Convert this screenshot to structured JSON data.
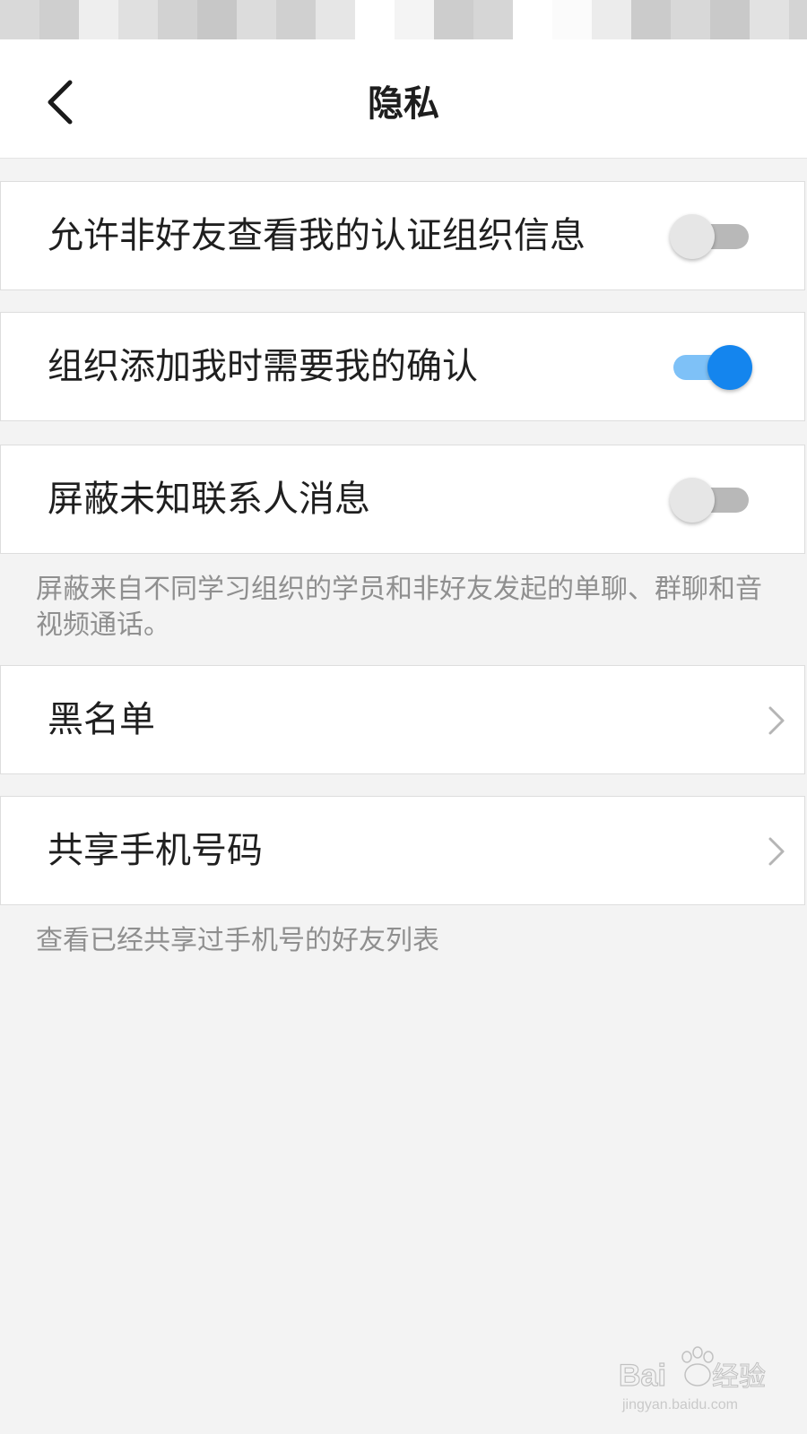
{
  "header": {
    "title": "隐私"
  },
  "settings": {
    "allow_nonfriend_view_org": {
      "label": "允许非好友查看我的认证组织信息",
      "enabled": false
    },
    "org_add_requires_confirm": {
      "label": "组织添加我时需要我的确认",
      "enabled": true
    },
    "block_unknown_contacts": {
      "label": "屏蔽未知联系人消息",
      "enabled": false,
      "description": "屏蔽来自不同学习组织的学员和非好友发起的单聊、群聊和音视频通话。"
    },
    "blacklist": {
      "label": "黑名单"
    },
    "share_phone": {
      "label": "共享手机号码",
      "description": "查看已经共享过手机号的好友列表"
    }
  },
  "colors": {
    "accent": "#1485ee",
    "accent_track": "#7ec1f7",
    "background": "#f3f3f3",
    "description_text": "#8f8f8f"
  },
  "icons": {
    "back": "chevron-left-icon",
    "row_arrow": "chevron-right-icon"
  },
  "watermark": {
    "text": "Baidu经验",
    "url_text": "jingyan.baidu.com"
  }
}
